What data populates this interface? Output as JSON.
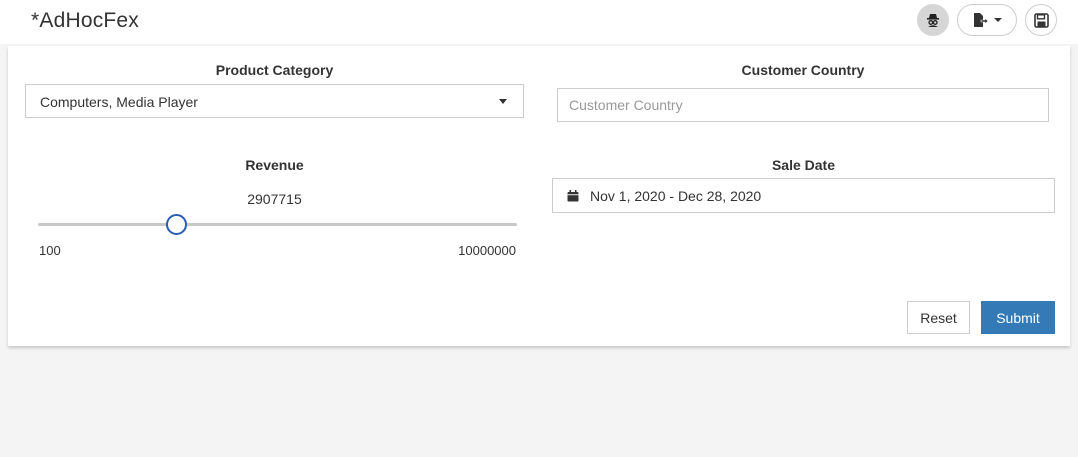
{
  "header": {
    "title": "*AdHocFex",
    "icons": [
      "user-secret-icon",
      "export-icon",
      "chevron-down-icon",
      "save-icon"
    ]
  },
  "form": {
    "product_category": {
      "label": "Product Category",
      "value": "Computers, Media Player"
    },
    "customer_country": {
      "label": "Customer Country",
      "placeholder": "Customer Country"
    },
    "revenue": {
      "label": "Revenue",
      "value": "2907715",
      "min": "100",
      "max": "10000000",
      "position_fraction": 0.29
    },
    "sale_date": {
      "label": "Sale Date",
      "value": "Nov 1, 2020 - Dec 28, 2020"
    },
    "buttons": {
      "reset": "Reset",
      "submit": "Submit"
    }
  },
  "colors": {
    "accent": "#337ab7",
    "slider_thumb": "#2a5db0",
    "background": "#f4f4f4"
  }
}
